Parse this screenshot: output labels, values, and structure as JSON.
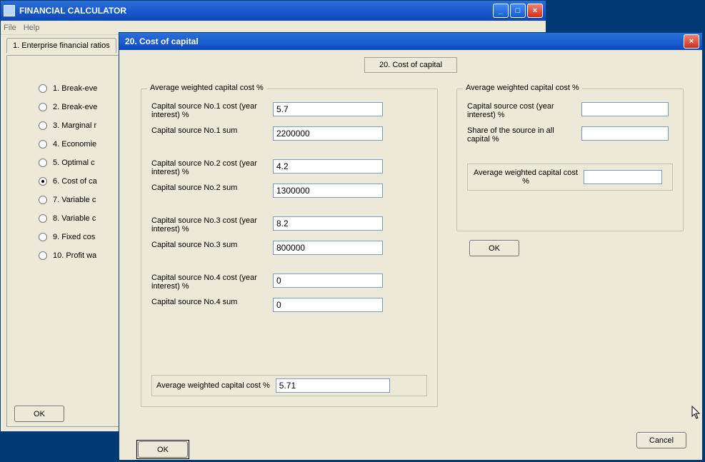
{
  "main_window": {
    "title": "FINANCIAL CALCULATOR",
    "menus": {
      "file": "File",
      "help": "Help"
    },
    "tab_label": "1. Enterprise financial ratios",
    "radios": [
      "1. Break-eve",
      "2. Break-eve",
      "3. Marginal r",
      "4. Economie",
      "5. Optimal c",
      "6. Cost of ca",
      "7. Variable c",
      "8. Variable c",
      "9. Fixed cos",
      "10. Profit wa"
    ],
    "selected_index": 5,
    "ok_label": "OK"
  },
  "dialog": {
    "title": "20. Cost of capital",
    "tab_label": "20. Cost of capital",
    "left_group": {
      "legend": "Average weighted capital cost %",
      "rows": [
        {
          "label": "Capital source No.1 cost (year interest) %",
          "value": "5.7"
        },
        {
          "label": "Capital source No.1 sum",
          "value": "2200000"
        },
        {
          "label": "Capital source No.2 cost (year interest) %",
          "value": "4.2"
        },
        {
          "label": "Capital source No.2 sum",
          "value": "1300000"
        },
        {
          "label": "Capital source No.3 cost (year interest) %",
          "value": "8.2"
        },
        {
          "label": "Capital source No.3 sum",
          "value": "800000"
        },
        {
          "label": "Capital source No.4 cost (year interest) %",
          "value": "0"
        },
        {
          "label": "Capital source No.4 sum",
          "value": "0"
        }
      ],
      "result_label": "Average weighted capital cost %",
      "result_value": "5.71"
    },
    "right_group": {
      "legend": "Average weighted capital cost %",
      "rows": [
        {
          "label": "Capital source cost (year interest) %",
          "value": ""
        },
        {
          "label": "Share of the source in all capital %",
          "value": ""
        }
      ],
      "result_label": "Average weighted capital cost %",
      "result_value": ""
    },
    "ok_label": "OK",
    "cancel_label": "Cancel"
  }
}
